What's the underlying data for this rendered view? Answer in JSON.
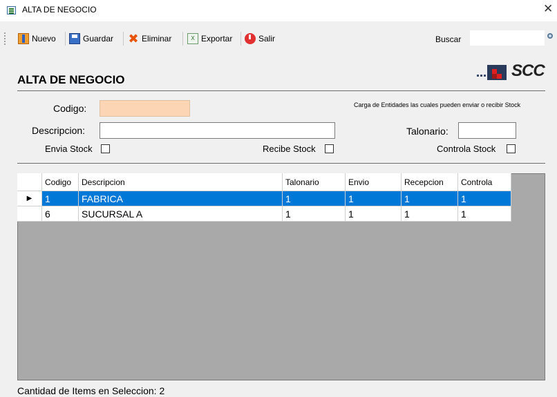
{
  "window": {
    "title": "ALTA DE NEGOCIO",
    "close": "✕"
  },
  "toolbar": {
    "nuevo": "Nuevo",
    "guardar": "Guardar",
    "eliminar": "Eliminar",
    "exportar": "Exportar",
    "salir": "Salir",
    "buscar_label": "Buscar",
    "buscar_value": ""
  },
  "header": {
    "title": "ALTA DE NEGOCIO",
    "logo_text": "SCC"
  },
  "form": {
    "codigo_label": "Codigo:",
    "codigo_value": "",
    "descripcion_label": "Descripcion:",
    "descripcion_value": "",
    "talonario_label": "Talonario:",
    "talonario_value": "",
    "note": "Carga de Entidades las cuales pueden enviar o recibir Stock",
    "envia_stock_label": "Envia Stock",
    "recibe_stock_label": "Recibe Stock",
    "controla_stock_label": "Controla Stock"
  },
  "table": {
    "columns": [
      "Codigo",
      "Descripcion",
      "Talonario",
      "Envio",
      "Recepcion",
      "Controla"
    ],
    "rows": [
      [
        "1",
        "FABRICA",
        "1",
        "1",
        "1",
        "1"
      ],
      [
        "6",
        "SUCURSAL A",
        "1",
        "1",
        "1",
        "1"
      ]
    ],
    "selected_row": 0
  },
  "status": {
    "text": "Cantidad de Items en Seleccion: 2"
  },
  "colors": {
    "selection": "#0078d7",
    "grid_bg": "#a9a9a9",
    "codigo_bg": "#fcd5b4"
  }
}
